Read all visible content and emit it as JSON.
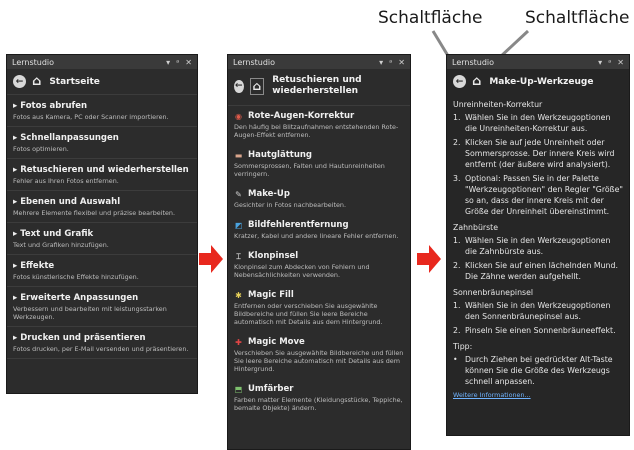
{
  "callouts": [
    "Schaltfläche",
    "Schaltfläche"
  ],
  "panels": {
    "left": {
      "title": "Lernstudio",
      "heading": "Startseite",
      "items": [
        {
          "title": "Fotos abrufen",
          "desc": "Fotos aus Kamera, PC oder Scanner importieren."
        },
        {
          "title": "Schnellanpassungen",
          "desc": "Fotos optimieren."
        },
        {
          "title": "Retuschieren und wiederherstellen",
          "desc": "Fehler aus Ihren Fotos entfernen."
        },
        {
          "title": "Ebenen und Auswahl",
          "desc": "Mehrere Elemente flexibel und präzise bearbeiten."
        },
        {
          "title": "Text und Grafik",
          "desc": "Text und Grafiken hinzufügen."
        },
        {
          "title": "Effekte",
          "desc": "Fotos künstlerische Effekte hinzufügen."
        },
        {
          "title": "Erweiterte Anpassungen",
          "desc": "Verbessern und bearbeiten mit leistungsstarken Werkzeugen."
        },
        {
          "title": "Drucken und präsentieren",
          "desc": "Fotos drucken, per E-Mail versenden und präsentieren."
        }
      ]
    },
    "middle": {
      "title": "Lernstudio",
      "heading": "Retuschieren und wiederherstellen",
      "items": [
        {
          "title": "Rote-Augen-Korrektur",
          "desc": "Den häufig bei Blitzaufnahmen entstehenden Rote-Augen-Effekt entfernen.",
          "icon": "eye-icon",
          "color": "#e05a4a",
          "glyph": "◉"
        },
        {
          "title": "Hautglättung",
          "desc": "Sommersprossen, Falten und Hautunreinheiten verringern.",
          "icon": "skin-icon",
          "color": "#d9a58c",
          "glyph": "▬"
        },
        {
          "title": "Make-Up",
          "desc": "Gesichter in Fotos nachbearbeiten.",
          "icon": "brush-icon",
          "color": "#cfcfcf",
          "glyph": "✎"
        },
        {
          "title": "Bildfehlerentfernung",
          "desc": "Kratzer, Kabel und andere lineare Fehler entfernen.",
          "icon": "healing-icon",
          "color": "#4aa3df",
          "glyph": "◩"
        },
        {
          "title": "Klonpinsel",
          "desc": "Klonpinsel zum Abdecken von Fehlern und Nebensächlichkeiten verwenden.",
          "icon": "clone-icon",
          "color": "#cfcfcf",
          "glyph": "⌶"
        },
        {
          "title": "Magic Fill",
          "desc": "Entfernen oder verschieben Sie ausgewählte Bildbereiche und füllen Sie leere Bereiche automatisch mit Details aus dem Hintergrund.",
          "icon": "magic-fill-icon",
          "color": "#e8d25a",
          "glyph": "✱"
        },
        {
          "title": "Magic Move",
          "desc": "Verschieben Sie ausgewählte Bildbereiche und füllen Sie leere Bereiche automatisch mit Details aus dem Hintergrund.",
          "icon": "move-icon",
          "color": "#e04545",
          "glyph": "✚"
        },
        {
          "title": "Umfärber",
          "desc": "Farben matter Elemente (Kleidungsstücke, Teppiche, bemalte Objekte) ändern.",
          "icon": "recolor-icon",
          "color": "#7ec06e",
          "glyph": "⬒"
        }
      ]
    },
    "right": {
      "title": "Lernstudio",
      "heading": "Make-Up-Werkzeuge",
      "sections": [
        {
          "header": "Unreinheiten-Korrektur",
          "steps": [
            {
              "n": "1.",
              "text": "Wählen Sie in den Werkzeugoptionen die Unreinheiten-Korrektur aus."
            },
            {
              "n": "2.",
              "text": "Klicken Sie auf jede Unreinheit oder Sommersprosse. Der innere Kreis wird entfernt (der äußere wird analysiert)."
            },
            {
              "n": "3.",
              "text": "Optional: Passen Sie in der Palette \"Werkzeugoptionen\" den Regler \"Größe\" so an, dass der innere Kreis mit der Größe der Unreinheit übereinstimmt."
            }
          ]
        },
        {
          "header": "Zahnbürste",
          "steps": [
            {
              "n": "1.",
              "text": "Wählen Sie in den Werkzeugoptionen die Zahnbürste aus."
            },
            {
              "n": "2.",
              "text": "Klicken Sie auf einen lächelnden Mund. Die Zähne werden aufgehellt."
            }
          ]
        },
        {
          "header": "Sonnenbräunepinsel",
          "steps": [
            {
              "n": "1.",
              "text": "Wählen Sie in den Werkzeugoptionen den Sonnenbräunepinsel aus."
            },
            {
              "n": "2.",
              "text": "Pinseln Sie einen Sonnenbräuneeffekt."
            }
          ]
        },
        {
          "header": "Tipp:",
          "steps": [
            {
              "n": "•",
              "text": "Durch Ziehen bei gedrückter Alt-Taste können Sie die Größe des Werkzeugs schnell anpassen."
            }
          ]
        }
      ],
      "link": "Weitere Informationen..."
    }
  },
  "colors": {
    "arrow": "#e8281e",
    "link": "#6fb3ff"
  }
}
